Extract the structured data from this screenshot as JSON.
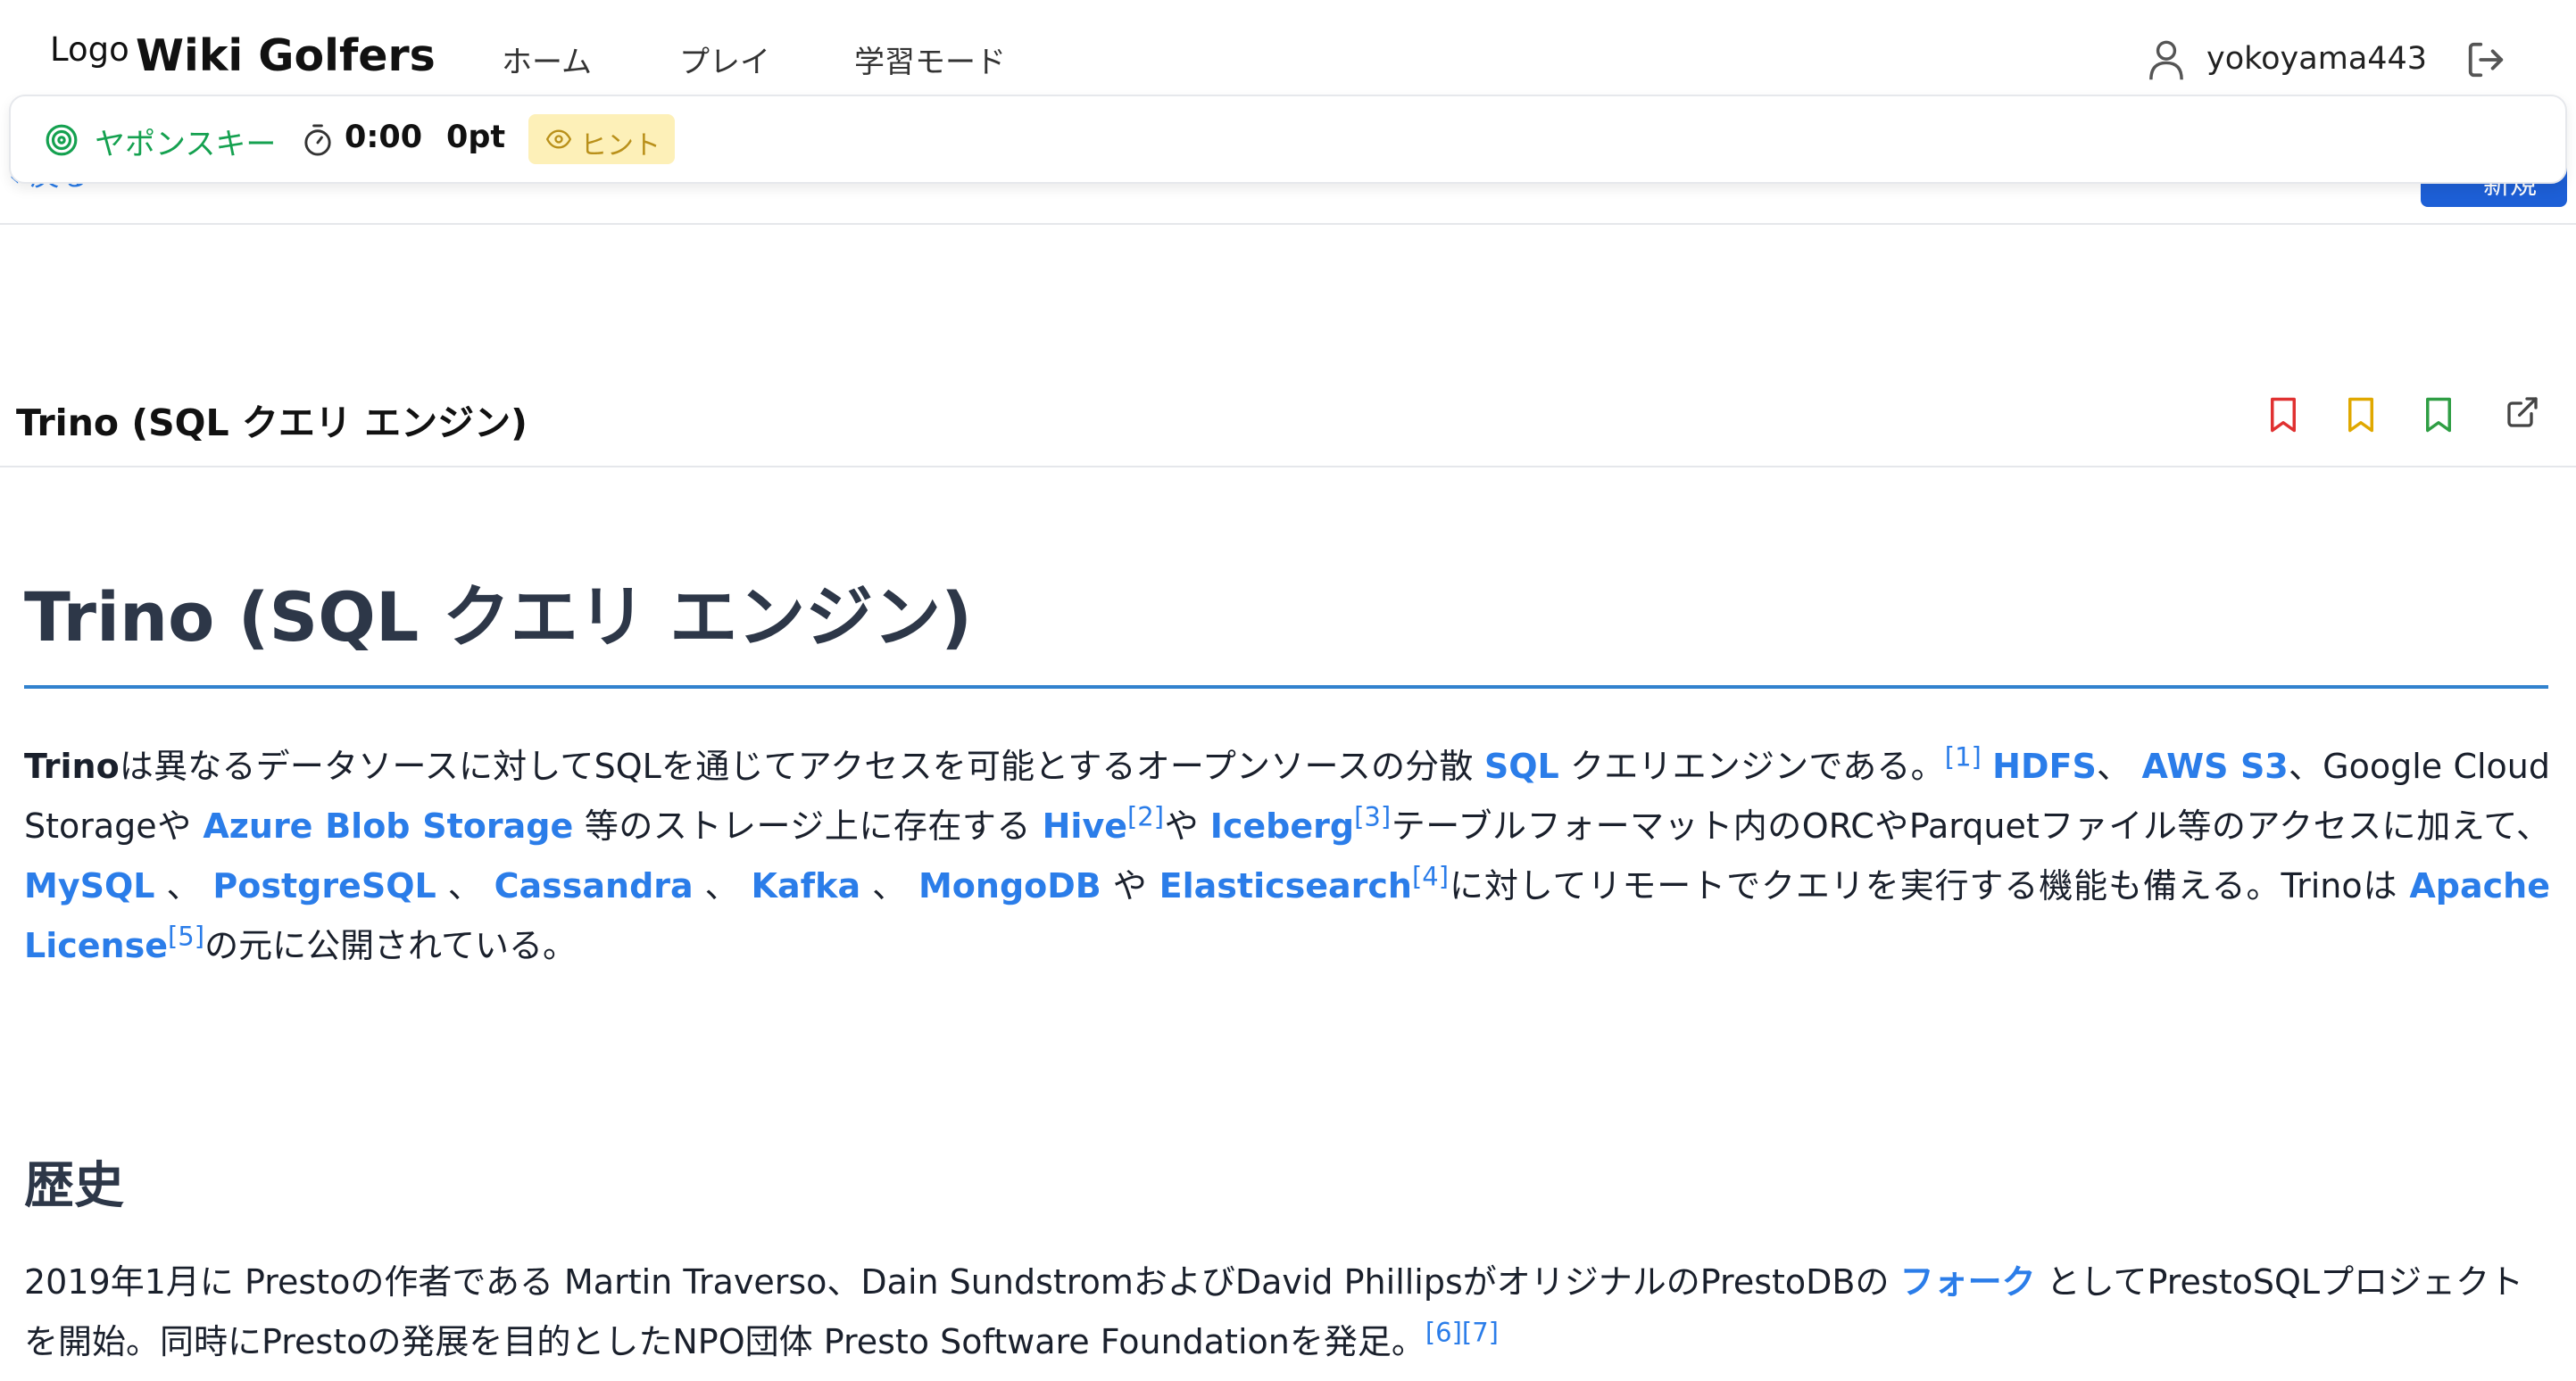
{
  "app": {
    "logo_small": "Logo",
    "logo_text": "Wiki Golfers",
    "nav": [
      {
        "label": "ホーム"
      },
      {
        "label": "プレイ"
      },
      {
        "label": "学習モード"
      }
    ],
    "username": "yokoyama443"
  },
  "subtoolbar": {
    "back_label": "戻る",
    "refresh_label": "新規"
  },
  "game": {
    "target_label": "ヤポンスキー",
    "timer": "0:00",
    "score": "0pt",
    "hint_label": "ヒント",
    "colors": {
      "target": "#15a150",
      "hint_bg": "#fdf0b8",
      "hint_fg": "#b9901a"
    }
  },
  "article": {
    "bar_title": "Trino (SQL クエリ エンジン)",
    "bookmark_colors": [
      "#e03131",
      "#e0a800",
      "#2f9e44"
    ],
    "title": "Trino (SQL クエリ エンジン)",
    "intro": {
      "t_trino": "Trino",
      "t1": "は異なるデータソースに対してSQLを通じてアクセスを可能とするオープンソースの分散 ",
      "l_sql": "SQL",
      "t2": " クエリエンジンである。",
      "r1": "[1]",
      "l_hdfs": "HDFS",
      "t3": "、 ",
      "l_s3": "AWS S3",
      "t4": "、Google Cloud Storageや ",
      "l_azure": "Azure Blob Storage",
      "t5": "  等のストレージ上に存在する ",
      "l_hive": "Hive",
      "r2": "[2]",
      "t6": "や ",
      "l_iceberg": "Iceberg",
      "r3": "[3]",
      "t7": "テーブルフォーマット内のORCやParquetファイル等のアクセスに加えて、 ",
      "l_mysql": "MySQL",
      "t8": " 、 ",
      "l_pg": "PostgreSQL",
      "t9": " 、 ",
      "l_cass": "Cassandra",
      "t10": " 、 ",
      "l_kafka": "Kafka",
      "t11": " 、 ",
      "l_mongo": "MongoDB",
      "t12": " や ",
      "l_es": "Elasticsearch",
      "r4": "[4]",
      "t13": "に対してリモートでクエリを実行する機能も備える。Trinoは ",
      "l_apache": "Apache License",
      "r5": "[5]",
      "t14": "の元に公開されている。"
    },
    "history": {
      "heading": "歴史",
      "t1": "2019年1月に Prestoの作者である Martin Traverso、Dain SundstromおよびDavid PhillipsがオリジナルのPrestoDBの ",
      "l_fork": "フォーク",
      "t2": " としてPrestoSQLプロジェクトを開始。同時にPrestoの発展を目的としたNPO団体 Presto Software Foundationを発足。",
      "r67": "[6][7]"
    }
  }
}
